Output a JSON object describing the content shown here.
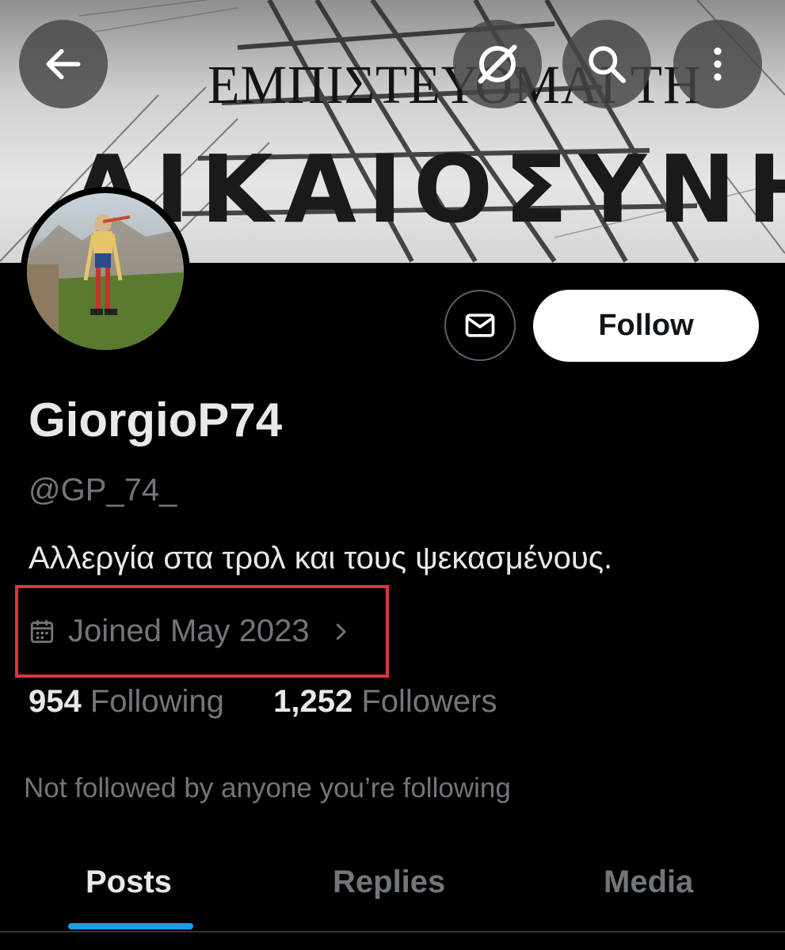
{
  "banner": {
    "line1": "ΕΜΠΙΣΤΕΥΟΜΑΙ ΤΗ",
    "line2": "ΔΙΚΑΙΟΣΥΝΗ"
  },
  "header": {
    "icons": [
      "back-arrow-icon",
      "grok-icon",
      "search-icon",
      "more-vertical-icon"
    ]
  },
  "profile": {
    "display_name": "GiorgioP74",
    "handle": "@GP_74_",
    "bio": "Αλλεργία στα τρολ και τους ψεκασμένους.",
    "joined": "Joined May 2023",
    "following_count": "954",
    "following_label": "Following",
    "followers_count": "1,252",
    "followers_label": "Followers",
    "mutuals_note": "Not followed by anyone you’re following"
  },
  "actions": {
    "follow_label": "Follow"
  },
  "tabs": [
    {
      "label": "Posts",
      "active": true
    },
    {
      "label": "Replies",
      "active": false
    },
    {
      "label": "Media",
      "active": false
    }
  ],
  "colors": {
    "accent": "#1d9bf0",
    "highlight_box": "#d9363e",
    "muted_text": "#71767b",
    "background": "#000000"
  }
}
